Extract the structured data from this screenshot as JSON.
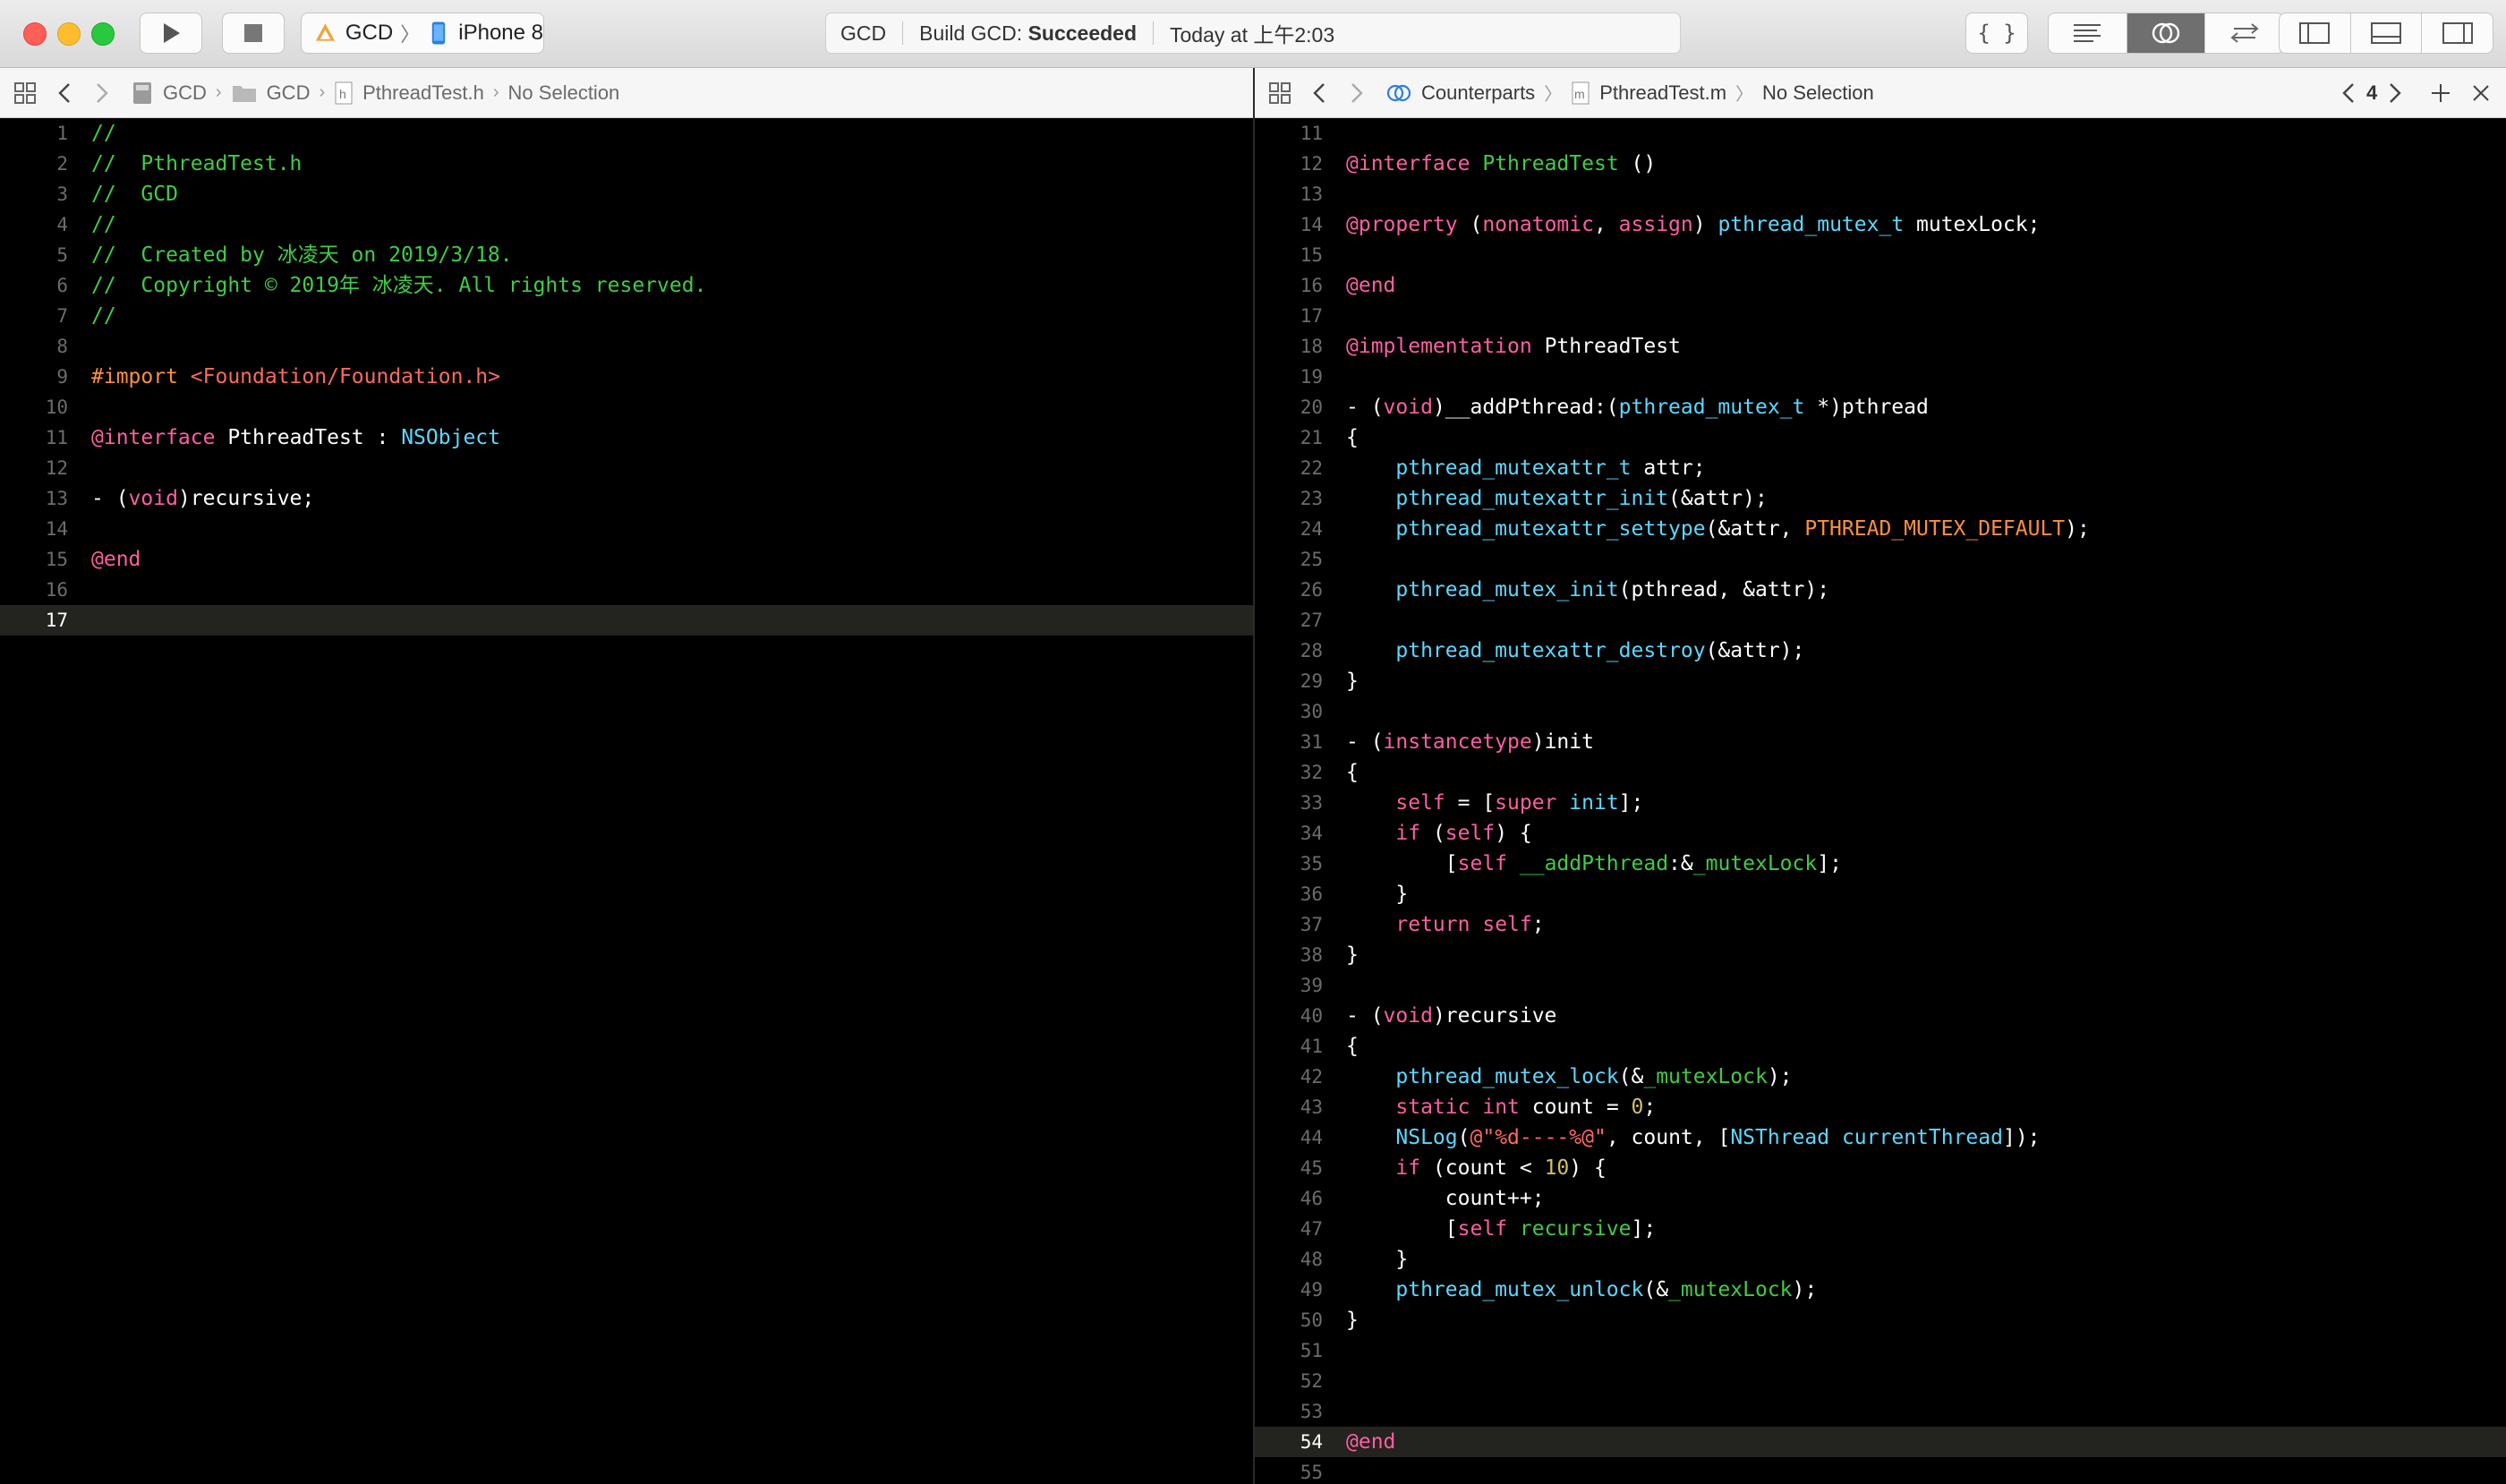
{
  "toolbar": {
    "scheme_target": "GCD",
    "scheme_device": "iPhone 8",
    "activity_project": "GCD",
    "activity_status_prefix": "Build GCD: ",
    "activity_status": "Succeeded",
    "activity_time": "Today at 上午2:03"
  },
  "left_editor": {
    "breadcrumb": [
      "GCD",
      "GCD",
      "PthreadTest.h",
      "No Selection"
    ],
    "current_line": 17,
    "lines": [
      {
        "n": 1,
        "tokens": [
          [
            "c-comment",
            "//"
          ]
        ]
      },
      {
        "n": 2,
        "tokens": [
          [
            "c-comment",
            "//  PthreadTest.h"
          ]
        ]
      },
      {
        "n": 3,
        "tokens": [
          [
            "c-comment",
            "//  GCD"
          ]
        ]
      },
      {
        "n": 4,
        "tokens": [
          [
            "c-comment",
            "//"
          ]
        ]
      },
      {
        "n": 5,
        "tokens": [
          [
            "c-comment",
            "//  Created by 冰凌天 on 2019/3/18."
          ]
        ]
      },
      {
        "n": 6,
        "tokens": [
          [
            "c-comment",
            "//  Copyright © 2019年 冰凌天. All rights reserved."
          ]
        ]
      },
      {
        "n": 7,
        "tokens": [
          [
            "c-comment",
            "//"
          ]
        ]
      },
      {
        "n": 8,
        "tokens": []
      },
      {
        "n": 9,
        "tokens": [
          [
            "c-pp",
            "#import "
          ],
          [
            "c-str",
            "<Foundation/Foundation.h>"
          ]
        ]
      },
      {
        "n": 10,
        "tokens": []
      },
      {
        "n": 11,
        "tokens": [
          [
            "c-kw",
            "@interface"
          ],
          [
            "c-plain",
            " PthreadTest : "
          ],
          [
            "c-type",
            "NSObject"
          ]
        ]
      },
      {
        "n": 12,
        "tokens": []
      },
      {
        "n": 13,
        "tokens": [
          [
            "c-plain",
            "- ("
          ],
          [
            "c-kw",
            "void"
          ],
          [
            "c-plain",
            ")recursive;"
          ]
        ]
      },
      {
        "n": 14,
        "tokens": []
      },
      {
        "n": 15,
        "tokens": [
          [
            "c-kw",
            "@end"
          ]
        ]
      },
      {
        "n": 16,
        "tokens": []
      },
      {
        "n": 17,
        "tokens": []
      }
    ]
  },
  "right_editor": {
    "breadcrumb_counterparts": "Counterparts",
    "breadcrumb_file": "PthreadTest.m",
    "breadcrumb_selection": "No Selection",
    "counterpart_index": "4",
    "current_line": 54,
    "lines": [
      {
        "n": 11,
        "tokens": []
      },
      {
        "n": 12,
        "tokens": [
          [
            "c-kw",
            "@interface"
          ],
          [
            "c-plain",
            " "
          ],
          [
            "c-prop",
            "PthreadTest"
          ],
          [
            "c-plain",
            " ()"
          ]
        ]
      },
      {
        "n": 13,
        "tokens": []
      },
      {
        "n": 14,
        "tokens": [
          [
            "c-kw",
            "@property"
          ],
          [
            "c-plain",
            " ("
          ],
          [
            "c-kw",
            "nonatomic"
          ],
          [
            "c-plain",
            ", "
          ],
          [
            "c-kw",
            "assign"
          ],
          [
            "c-plain",
            ") "
          ],
          [
            "c-type",
            "pthread_mutex_t"
          ],
          [
            "c-plain",
            " mutexLock;"
          ]
        ]
      },
      {
        "n": 15,
        "tokens": []
      },
      {
        "n": 16,
        "tokens": [
          [
            "c-kw",
            "@end"
          ]
        ]
      },
      {
        "n": 17,
        "tokens": []
      },
      {
        "n": 18,
        "tokens": [
          [
            "c-kw",
            "@implementation"
          ],
          [
            "c-plain",
            " PthreadTest"
          ]
        ]
      },
      {
        "n": 19,
        "tokens": []
      },
      {
        "n": 20,
        "tokens": [
          [
            "c-plain",
            "- ("
          ],
          [
            "c-kw",
            "void"
          ],
          [
            "c-plain",
            ")__addPthread:("
          ],
          [
            "c-type",
            "pthread_mutex_t"
          ],
          [
            "c-plain",
            " *)pthread"
          ]
        ]
      },
      {
        "n": 21,
        "tokens": [
          [
            "c-plain",
            "{"
          ]
        ]
      },
      {
        "n": 22,
        "tokens": [
          [
            "c-plain",
            "    "
          ],
          [
            "c-type",
            "pthread_mutexattr_t"
          ],
          [
            "c-plain",
            " attr;"
          ]
        ]
      },
      {
        "n": 23,
        "tokens": [
          [
            "c-plain",
            "    "
          ],
          [
            "c-type",
            "pthread_mutexattr_init"
          ],
          [
            "c-plain",
            "(&attr);"
          ]
        ]
      },
      {
        "n": 24,
        "tokens": [
          [
            "c-plain",
            "    "
          ],
          [
            "c-type",
            "pthread_mutexattr_settype"
          ],
          [
            "c-plain",
            "(&attr, "
          ],
          [
            "c-macro",
            "PTHREAD_MUTEX_DEFAULT"
          ],
          [
            "c-plain",
            ");"
          ]
        ]
      },
      {
        "n": 25,
        "tokens": []
      },
      {
        "n": 26,
        "tokens": [
          [
            "c-plain",
            "    "
          ],
          [
            "c-type",
            "pthread_mutex_init"
          ],
          [
            "c-plain",
            "(pthread, &attr);"
          ]
        ]
      },
      {
        "n": 27,
        "tokens": []
      },
      {
        "n": 28,
        "tokens": [
          [
            "c-plain",
            "    "
          ],
          [
            "c-type",
            "pthread_mutexattr_destroy"
          ],
          [
            "c-plain",
            "(&attr);"
          ]
        ]
      },
      {
        "n": 29,
        "tokens": [
          [
            "c-plain",
            "}"
          ]
        ]
      },
      {
        "n": 30,
        "tokens": []
      },
      {
        "n": 31,
        "tokens": [
          [
            "c-plain",
            "- ("
          ],
          [
            "c-kw",
            "instancetype"
          ],
          [
            "c-plain",
            ")init"
          ]
        ]
      },
      {
        "n": 32,
        "tokens": [
          [
            "c-plain",
            "{"
          ]
        ]
      },
      {
        "n": 33,
        "tokens": [
          [
            "c-plain",
            "    "
          ],
          [
            "c-kw",
            "self"
          ],
          [
            "c-plain",
            " = ["
          ],
          [
            "c-kw",
            "super"
          ],
          [
            "c-plain",
            " "
          ],
          [
            "c-type",
            "init"
          ],
          [
            "c-plain",
            "];"
          ]
        ]
      },
      {
        "n": 34,
        "tokens": [
          [
            "c-plain",
            "    "
          ],
          [
            "c-kw",
            "if"
          ],
          [
            "c-plain",
            " ("
          ],
          [
            "c-kw",
            "self"
          ],
          [
            "c-plain",
            ") {"
          ]
        ]
      },
      {
        "n": 35,
        "tokens": [
          [
            "c-plain",
            "        ["
          ],
          [
            "c-kw",
            "self"
          ],
          [
            "c-plain",
            " "
          ],
          [
            "c-prop",
            "__addPthread"
          ],
          [
            "c-plain",
            ":&"
          ],
          [
            "c-prop",
            "_mutexLock"
          ],
          [
            "c-plain",
            "];"
          ]
        ]
      },
      {
        "n": 36,
        "tokens": [
          [
            "c-plain",
            "    }"
          ]
        ]
      },
      {
        "n": 37,
        "tokens": [
          [
            "c-plain",
            "    "
          ],
          [
            "c-kw",
            "return"
          ],
          [
            "c-plain",
            " "
          ],
          [
            "c-kw",
            "self"
          ],
          [
            "c-plain",
            ";"
          ]
        ]
      },
      {
        "n": 38,
        "tokens": [
          [
            "c-plain",
            "}"
          ]
        ]
      },
      {
        "n": 39,
        "tokens": []
      },
      {
        "n": 40,
        "tokens": [
          [
            "c-plain",
            "- ("
          ],
          [
            "c-kw",
            "void"
          ],
          [
            "c-plain",
            ")recursive"
          ]
        ]
      },
      {
        "n": 41,
        "tokens": [
          [
            "c-plain",
            "{"
          ]
        ]
      },
      {
        "n": 42,
        "tokens": [
          [
            "c-plain",
            "    "
          ],
          [
            "c-type",
            "pthread_mutex_lock"
          ],
          [
            "c-plain",
            "(&"
          ],
          [
            "c-prop",
            "_mutexLock"
          ],
          [
            "c-plain",
            ");"
          ]
        ]
      },
      {
        "n": 43,
        "tokens": [
          [
            "c-plain",
            "    "
          ],
          [
            "c-kw",
            "static"
          ],
          [
            "c-plain",
            " "
          ],
          [
            "c-kw",
            "int"
          ],
          [
            "c-plain",
            " count = "
          ],
          [
            "c-num",
            "0"
          ],
          [
            "c-plain",
            ";"
          ]
        ]
      },
      {
        "n": 44,
        "tokens": [
          [
            "c-plain",
            "    "
          ],
          [
            "c-type",
            "NSLog"
          ],
          [
            "c-plain",
            "("
          ],
          [
            "c-str",
            "@\"%d----%@\""
          ],
          [
            "c-plain",
            ", count, ["
          ],
          [
            "c-type",
            "NSThread"
          ],
          [
            "c-plain",
            " "
          ],
          [
            "c-type",
            "currentThread"
          ],
          [
            "c-plain",
            "]);"
          ]
        ]
      },
      {
        "n": 45,
        "tokens": [
          [
            "c-plain",
            "    "
          ],
          [
            "c-kw",
            "if"
          ],
          [
            "c-plain",
            " (count < "
          ],
          [
            "c-num",
            "10"
          ],
          [
            "c-plain",
            ") {"
          ]
        ]
      },
      {
        "n": 46,
        "tokens": [
          [
            "c-plain",
            "        count++;"
          ]
        ]
      },
      {
        "n": 47,
        "tokens": [
          [
            "c-plain",
            "        ["
          ],
          [
            "c-kw",
            "self"
          ],
          [
            "c-plain",
            " "
          ],
          [
            "c-prop",
            "recursive"
          ],
          [
            "c-plain",
            "];"
          ]
        ]
      },
      {
        "n": 48,
        "tokens": [
          [
            "c-plain",
            "    }"
          ]
        ]
      },
      {
        "n": 49,
        "tokens": [
          [
            "c-plain",
            "    "
          ],
          [
            "c-type",
            "pthread_mutex_unlock"
          ],
          [
            "c-plain",
            "(&"
          ],
          [
            "c-prop",
            "_mutexLock"
          ],
          [
            "c-plain",
            ");"
          ]
        ]
      },
      {
        "n": 50,
        "tokens": [
          [
            "c-plain",
            "}"
          ]
        ]
      },
      {
        "n": 51,
        "tokens": []
      },
      {
        "n": 52,
        "tokens": []
      },
      {
        "n": 53,
        "tokens": []
      },
      {
        "n": 54,
        "tokens": [
          [
            "c-kw",
            "@end"
          ]
        ]
      },
      {
        "n": 55,
        "tokens": []
      }
    ]
  }
}
